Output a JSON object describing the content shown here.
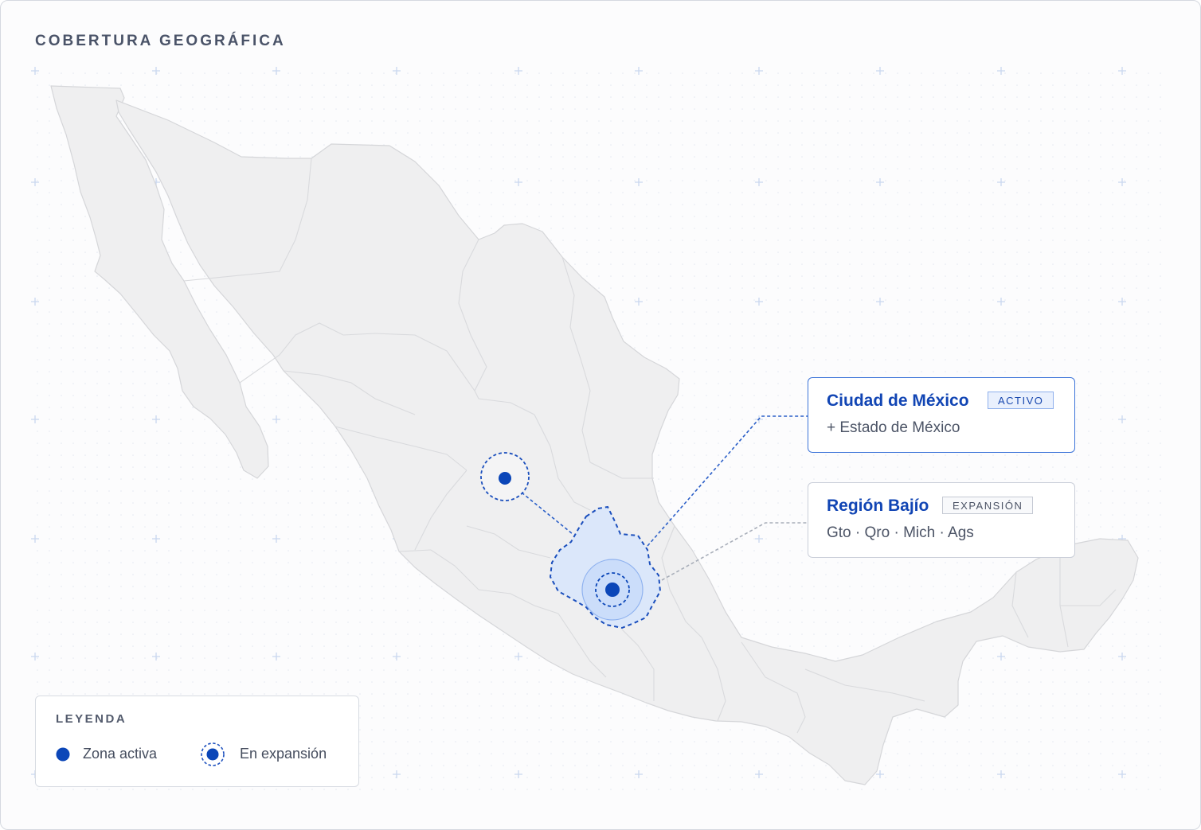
{
  "header": {
    "title": "COBERTURA GEOGRÁFICA"
  },
  "colors": {
    "accent": "#0b46b8",
    "land": "#efeff0",
    "land_border": "#d7d8db",
    "highlight_fill": "#d9e6fb",
    "grid_cross": "#c9d7ef"
  },
  "map": {
    "country": "Mexico",
    "markers": [
      {
        "id": "cdmx",
        "type": "active",
        "icon": "active-zone-marker"
      },
      {
        "id": "bajio",
        "type": "expansion",
        "icon": "expansion-zone-marker"
      }
    ]
  },
  "callouts": {
    "cdmx": {
      "title": "Ciudad de México",
      "badge": "ACTIVO",
      "subtitle": "+ Estado de México"
    },
    "bajio": {
      "title": "Región Bajío",
      "badge": "EXPANSIÓN",
      "subtitle": "Gto · Qro · Mich · Ags"
    }
  },
  "legend": {
    "title": "LEYENDA",
    "items": [
      {
        "label": "Zona activa",
        "icon": "filled-dot-icon"
      },
      {
        "label": "En expansión",
        "icon": "dashed-ring-dot-icon"
      }
    ]
  }
}
